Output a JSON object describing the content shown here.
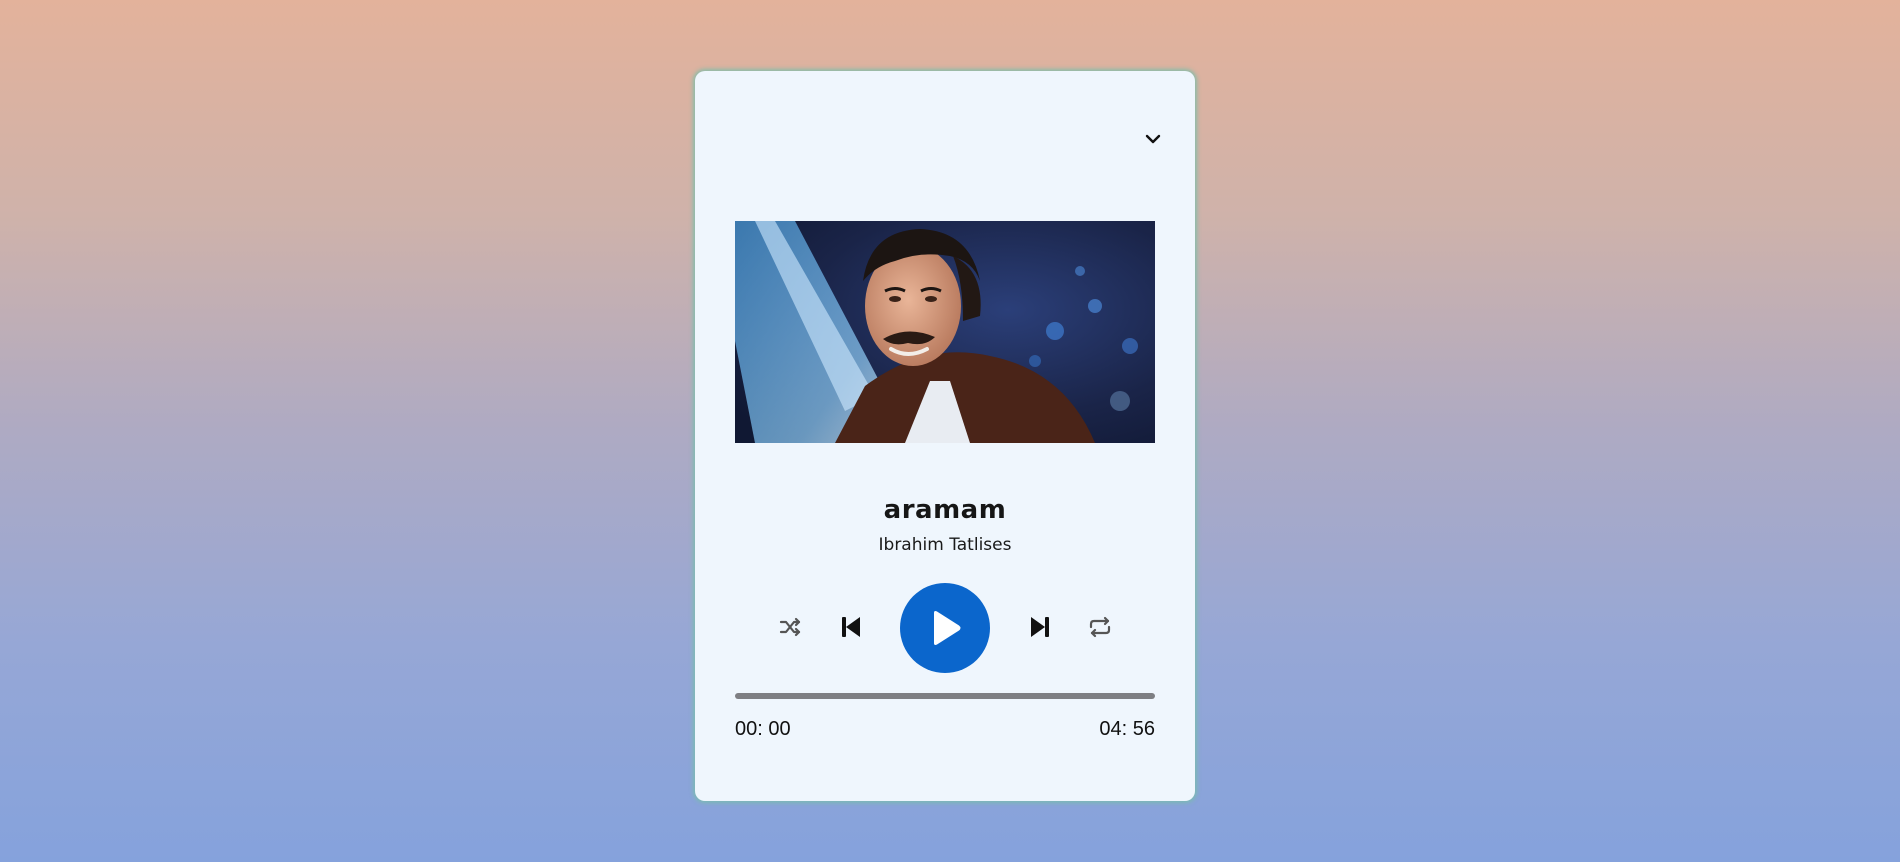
{
  "player": {
    "song_title": "aramam",
    "artist": "Ibrahim Tatlises",
    "current_time": "00: 00",
    "total_time": "04: 56",
    "progress": 0,
    "is_playing": false,
    "accent_color": "#0b66cc",
    "background_color": "#eff6fd"
  },
  "icons": {
    "collapse": "chevron-down-icon",
    "shuffle": "shuffle-icon",
    "previous": "skip-previous-icon",
    "play": "play-icon",
    "next": "skip-next-icon",
    "repeat": "repeat-icon"
  }
}
